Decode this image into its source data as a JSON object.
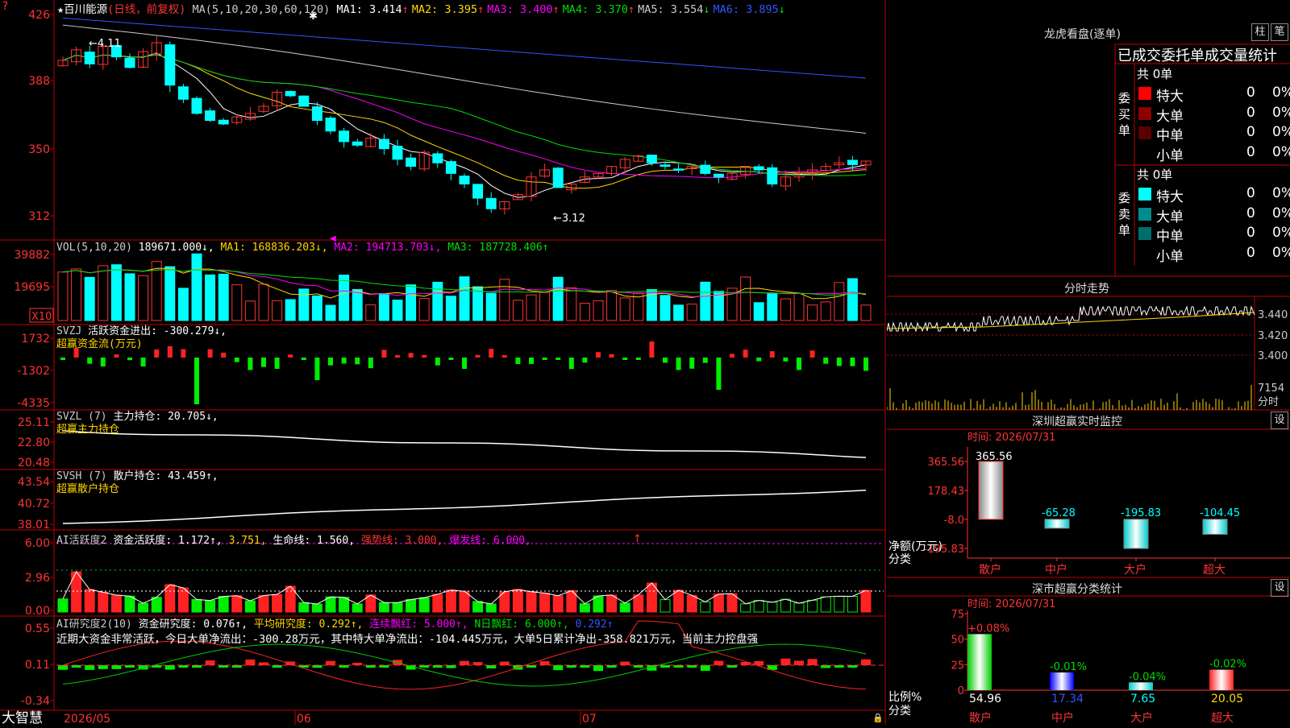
{
  "stock_title": "百川能源",
  "period_label": "(日线，前复权)",
  "ma_header": {
    "params": "MA(5,10,20,30,60,120)",
    "items": [
      {
        "label": "MA1: 3.414",
        "arrow": "↑",
        "color": "#ffffff"
      },
      {
        "label": "MA2: 3.395",
        "arrow": "↑",
        "color": "#ffd700"
      },
      {
        "label": "MA3: 3.400",
        "arrow": "↑",
        "color": "#ff00ff"
      },
      {
        "label": "MA4: 3.370",
        "arrow": "↑",
        "color": "#00dd00"
      },
      {
        "label": "MA5: 3.554",
        "arrow": "↓",
        "color": "#cccccc"
      },
      {
        "label": "MA6: 3.895",
        "arrow": "↓",
        "color": "#3355ff"
      }
    ]
  },
  "price_axis": [
    "426",
    "388",
    "350",
    "312"
  ],
  "price_annotations": {
    "high": "4.11",
    "low": "←3.12"
  },
  "vol_header": {
    "params": "VOL(5,10,20)",
    "value": "189671.000↓,",
    "ma1": "MA1: 168836.203↓,",
    "ma2": "MA2: 194713.703↓,",
    "ma3": "MA3: 187728.406↑"
  },
  "vol_axis": [
    "39882",
    "19695"
  ],
  "vol_unit": "X10",
  "svzj_header": {
    "name": "SVZJ",
    "label": "活跃资金进出: -300.279↓,",
    "subtitle": "超赢资金流(万元)"
  },
  "svzj_axis": [
    "1732",
    "-1302",
    "-4335"
  ],
  "svzl_header": {
    "name": "SVZL (7)",
    "label": "主力持仓: 20.705↓,",
    "subtitle": "超赢主力持仓"
  },
  "svzl_axis": [
    "25.11",
    "22.80",
    "20.48"
  ],
  "svsh_header": {
    "name": "SVSH (7)",
    "label": "散户持仓: 43.459↑,",
    "subtitle": "超赢散户持仓"
  },
  "svsh_axis": [
    "43.54",
    "40.72",
    "38.01"
  ],
  "ai_active_header": {
    "name": "AI活跃度2",
    "p1": "资金活跃度: 1.172↑,",
    "p2": "3.751,",
    "p3": "生命线: 1.560,",
    "p4": "强势线: 3.000,",
    "p5": "爆发线: 6.000,"
  },
  "ai_active_axis": [
    "6.00",
    "2.96",
    "0.00"
  ],
  "ai_research_header": {
    "name": "AI研究度2(10)",
    "p1": "资金研究度: 0.076↑,",
    "p2": "平均研究度: 0.292↑,",
    "p3": "连续飘红: 5.000↑,",
    "p4": "N日飘红: 6.000↑,",
    "p5": "0.292↑"
  },
  "ai_research_text": "近期大资金非常活跃，今日大单净流出：-300.28万元，其中特大单净流出：-104.445万元，大单5日累计净出-358.821万元，当前主力控盘强",
  "ai_research_axis": [
    "0.55",
    "0.11",
    "-0.34"
  ],
  "date_axis": [
    "2026/05",
    "06",
    "07"
  ],
  "brand": "大智慧",
  "dragon_tiger": {
    "title": "龙虎看盘(逐单)",
    "btn_bar": "柱",
    "btn_pen": "笔",
    "headline": "已成交委托单成交量统计",
    "buy": {
      "side": [
        "委",
        "买",
        "单"
      ],
      "total": "共 0单",
      "rows": [
        {
          "label": "特大",
          "count": "0",
          "pct": "0%",
          "color": "#ff0000"
        },
        {
          "label": "大单",
          "count": "0",
          "pct": "0%",
          "color": "#8b0000"
        },
        {
          "label": "中单",
          "count": "0",
          "pct": "0%",
          "color": "#5a0000"
        },
        {
          "label": "小单",
          "count": "0",
          "pct": "0%",
          "color": ""
        }
      ]
    },
    "sell": {
      "side": [
        "委",
        "卖",
        "单"
      ],
      "total": "共 0单",
      "rows": [
        {
          "label": "特大",
          "count": "0",
          "pct": "0%",
          "color": "#00ffff"
        },
        {
          "label": "大单",
          "count": "0",
          "pct": "0%",
          "color": "#008b8b"
        },
        {
          "label": "中单",
          "count": "0",
          "pct": "0%",
          "color": "#006d6d"
        },
        {
          "label": "小单",
          "count": "0",
          "pct": "0%",
          "color": ""
        }
      ]
    }
  },
  "intraday": {
    "title": "分时走势",
    "price_axis": [
      "3.440",
      "3.420",
      "3.400"
    ],
    "vol_label": "7154",
    "time_label": "分时"
  },
  "monitor": {
    "title": "深圳超赢实时监控",
    "settings": "设",
    "time": "时间: 2026/07/31",
    "axis": [
      "365.56",
      "178.43",
      "-8.0",
      "-195.83"
    ],
    "ylabel": "净额(万元)",
    "xlabel": "分类",
    "bars": [
      {
        "category": "散户",
        "value": 365.56,
        "label": "365.56"
      },
      {
        "category": "中户",
        "value": -65.28,
        "label": "-65.28"
      },
      {
        "category": "大户",
        "value": -195.83,
        "label": "-195.83"
      },
      {
        "category": "超大",
        "value": -104.45,
        "label": "-104.45"
      }
    ]
  },
  "classify": {
    "title": "深市超赢分类统计",
    "settings": "设",
    "time": "时间: 2026/07/31",
    "axis": [
      "75",
      "50",
      "25",
      "0"
    ],
    "ylabel": "比例%",
    "xlabel": "分类",
    "bars": [
      {
        "category": "散户",
        "value": 54.96,
        "label": "54.96",
        "change": "+0.08%"
      },
      {
        "category": "中户",
        "value": 17.34,
        "label": "17.34",
        "change": "-0.01%"
      },
      {
        "category": "大户",
        "value": 7.65,
        "label": "7.65",
        "change": "-0.04%"
      },
      {
        "category": "超大",
        "value": 20.05,
        "label": "20.05",
        "change": "-0.02%"
      }
    ]
  }
}
